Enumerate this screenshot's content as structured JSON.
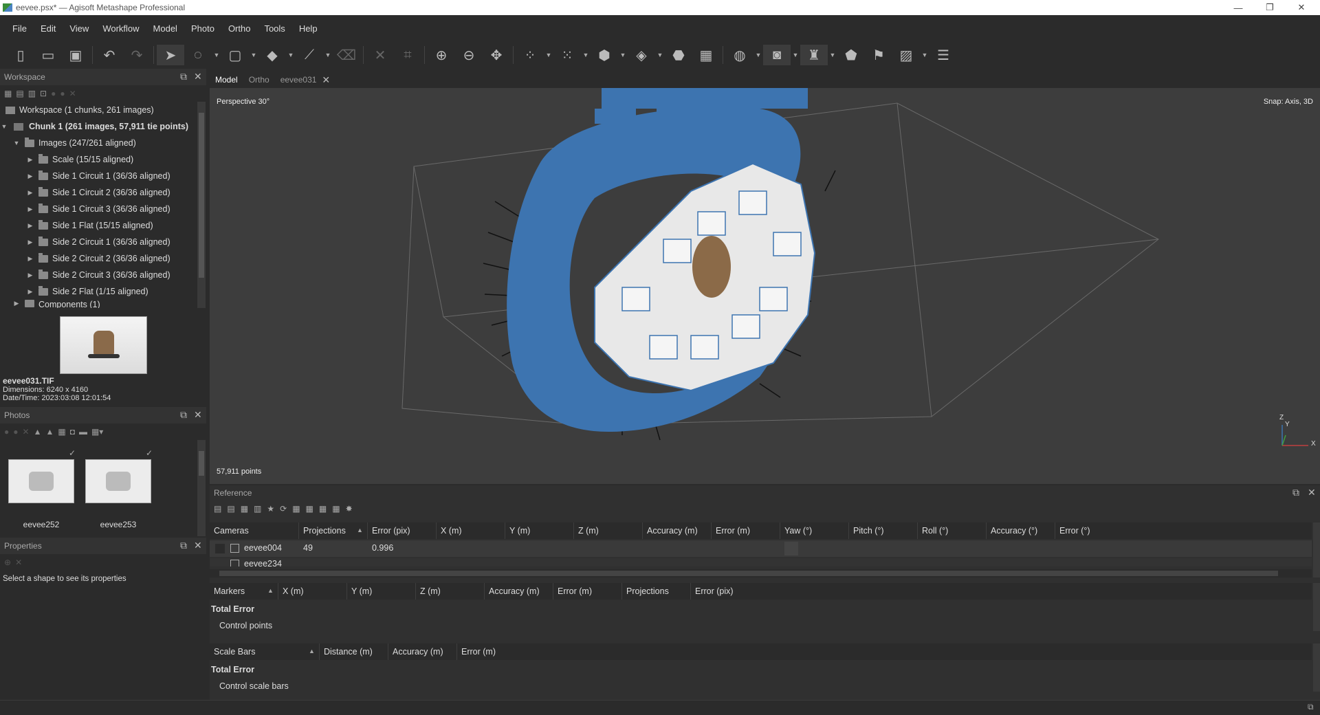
{
  "window": {
    "title": "eevee.psx* — Agisoft Metashape Professional",
    "minimize": "—",
    "restore": "❐",
    "close": "✕"
  },
  "menu": [
    "File",
    "Edit",
    "View",
    "Workflow",
    "Model",
    "Photo",
    "Ortho",
    "Tools",
    "Help"
  ],
  "workspace": {
    "title": "Workspace",
    "root": "Workspace (1 chunks, 261 images)",
    "chunk": "Chunk 1 (261 images, 57,911 tie points)",
    "images": "Images (247/261 aligned)",
    "groups": [
      "Scale (15/15 aligned)",
      "Side 1 Circuit 1 (36/36 aligned)",
      "Side 1 Circuit 2 (36/36 aligned)",
      "Side 1 Circuit 3 (36/36 aligned)",
      "Side 1 Flat (15/15 aligned)",
      "Side 2 Circuit 1 (36/36 aligned)",
      "Side 2 Circuit 2 (36/36 aligned)",
      "Side 2 Circuit 3 (36/36 aligned)",
      "Side 2 Flat (1/15 aligned)"
    ],
    "components": "Components (1)"
  },
  "preview": {
    "filename": "eevee031.TIF",
    "dimensions": "Dimensions: 6240 x 4160",
    "datetime": "Date/Time: 2023:03:08 12:01:54"
  },
  "photos": {
    "title": "Photos",
    "items": [
      {
        "label": "eevee252"
      },
      {
        "label": "eevee253"
      }
    ]
  },
  "properties": {
    "title": "Properties",
    "hint": "Select a shape to see its properties"
  },
  "tabs": [
    "Model",
    "Ortho",
    "eevee031"
  ],
  "viewport": {
    "projection": "Perspective 30°",
    "snap": "Snap: Axis, 3D",
    "points": "57,911 points",
    "axis_z": "Z",
    "axis_y": "Y",
    "axis_x": "X"
  },
  "reference": {
    "title": "Reference",
    "cameras_columns": [
      "Cameras",
      "Projections",
      "Error (pix)",
      "X (m)",
      "Y (m)",
      "Z (m)",
      "Accuracy (m)",
      "Error (m)",
      "Yaw (°)",
      "Pitch (°)",
      "Roll (°)",
      "Accuracy (°)",
      "Error (°)"
    ],
    "cameras_rows": [
      {
        "name": "eevee004",
        "projections": "49",
        "error": "0.996"
      },
      {
        "name": "eevee234",
        "projections": "",
        "error": ""
      }
    ],
    "markers_columns": [
      "Markers",
      "X (m)",
      "Y (m)",
      "Z (m)",
      "Accuracy (m)",
      "Error (m)",
      "Projections",
      "Error (pix)"
    ],
    "markers_total": "Total Error",
    "markers_control": "Control points",
    "scalebars_columns": [
      "Scale Bars",
      "Distance (m)",
      "Accuracy (m)",
      "Error (m)"
    ],
    "scalebars_total": "Total Error",
    "scalebars_control": "Control scale bars"
  },
  "colors": {
    "accent": "#3d74b0",
    "bg": "#2b2b2b",
    "viewport": "#3d3d3d"
  }
}
